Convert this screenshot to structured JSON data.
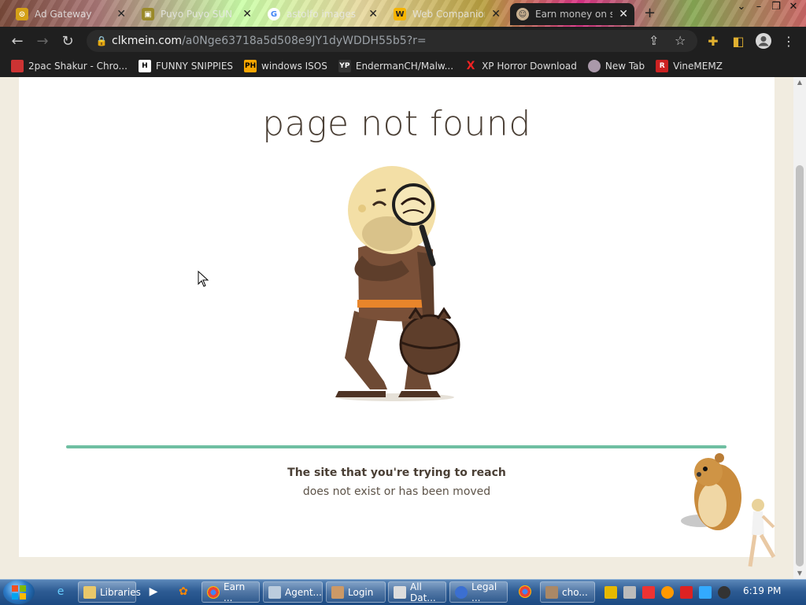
{
  "browser": {
    "tabs": [
      {
        "title": "Ad Gateway",
        "active": false
      },
      {
        "title": "Puyo Puyo SUN",
        "active": false
      },
      {
        "title": "astolfo images",
        "active": false
      },
      {
        "title": "Web Companion",
        "active": false
      },
      {
        "title": "Earn money on s",
        "active": true
      }
    ],
    "address": {
      "host": "clkmein.com",
      "path": "/a0Nge63718a5d508e9JY1dyWDDH55b5?r="
    },
    "bookmarks": [
      {
        "label": "2pac Shakur - Chro...",
        "icon_text": ""
      },
      {
        "label": "FUNNY SNIPPIES",
        "icon_text": "H"
      },
      {
        "label": "windows ISOS",
        "icon_text": "PH"
      },
      {
        "label": "EndermanCH/Malw...",
        "icon_text": "YP"
      },
      {
        "label": "XP Horror Download",
        "icon_text": "X"
      },
      {
        "label": "New Tab",
        "icon_text": ""
      },
      {
        "label": "VineMEMZ",
        "icon_text": "R"
      }
    ]
  },
  "page": {
    "heading": "page not found",
    "message_line1": "The site that you're trying to reach",
    "message_line2": "does not exist or has been moved"
  },
  "taskbar": {
    "items": [
      {
        "label": "Libraries"
      },
      {
        "label": "Earn ..."
      },
      {
        "label": "Agent..."
      },
      {
        "label": "Login"
      },
      {
        "label": "All Dat..."
      },
      {
        "label": "Legal ..."
      },
      {
        "label": "cho..."
      }
    ],
    "clock": "6:19 PM"
  },
  "colors": {
    "accent_divider": "#6fbfa2",
    "heading_text": "#4a3f35",
    "page_background": "#f1ece0"
  }
}
